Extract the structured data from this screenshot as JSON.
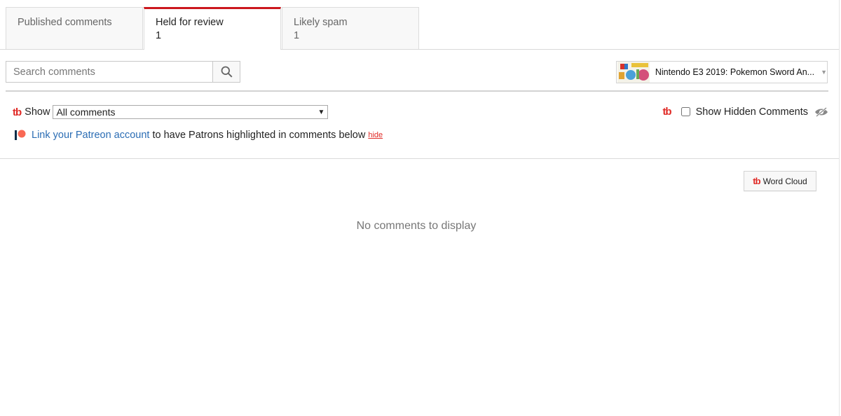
{
  "tabs": [
    {
      "label": "Published comments",
      "count": ""
    },
    {
      "label": "Held for review",
      "count": "1"
    },
    {
      "label": "Likely spam",
      "count": "1"
    }
  ],
  "search": {
    "placeholder": "Search comments"
  },
  "video_selector": {
    "title": "Nintendo E3 2019: Pokemon Sword An..."
  },
  "filter": {
    "show_label": "Show",
    "selected": "All comments"
  },
  "hidden_comments": {
    "label": "Show Hidden Comments",
    "checked": false
  },
  "patreon": {
    "link_text": "Link your Patreon account",
    "text": "to have Patrons highlighted in comments below",
    "hide": "hide"
  },
  "word_cloud": {
    "label": "Word Cloud"
  },
  "empty_state": {
    "message": "No comments to display"
  },
  "brand": {
    "tb_logo": "tb",
    "tb_color": "#e02a26",
    "youtube_red": "#cc181e",
    "patreon_color": "#f96854",
    "link_color": "#2b6db4"
  }
}
